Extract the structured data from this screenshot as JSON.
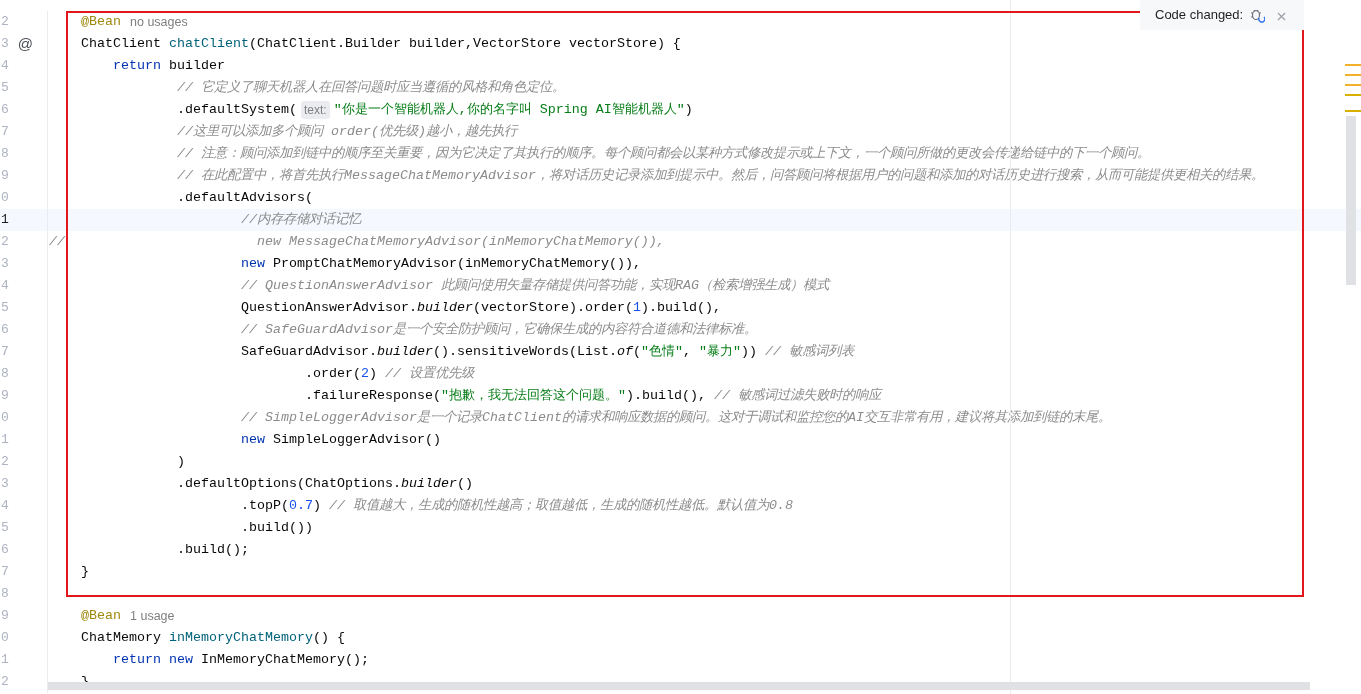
{
  "editor": {
    "lines": [
      {
        "number": "2",
        "current": false,
        "tokens": [
          {
            "text": "    @Bean",
            "kind": "annotation"
          },
          {
            "text": "no usages",
            "kind": "usage"
          }
        ]
      },
      {
        "number": "3",
        "current": false,
        "gutter_marker": "@",
        "tokens": [
          {
            "text": "    ChatClient ",
            "kind": "plain"
          },
          {
            "text": "chatClient",
            "kind": "declaration"
          },
          {
            "text": "(ChatClient.Builder builder,VectorStore vectorStore) {",
            "kind": "plain"
          }
        ]
      },
      {
        "number": "4",
        "current": false,
        "tokens": [
          {
            "text": "        return",
            "kind": "keyword"
          },
          {
            "text": " builder",
            "kind": "plain"
          }
        ]
      },
      {
        "number": "5",
        "current": false,
        "tokens": [
          {
            "text": "                // 它定义了聊天机器人在回答问题时应当遵循的风格和角色定位。",
            "kind": "comment"
          }
        ]
      },
      {
        "number": "6",
        "current": false,
        "tokens": [
          {
            "text": "                .defaultSystem(",
            "kind": "plain"
          },
          {
            "text": "text:",
            "kind": "hint"
          },
          {
            "text": "\"你是一个智能机器人,你的名字叫 Spring AI智能机器人\"",
            "kind": "string"
          },
          {
            "text": ")",
            "kind": "plain"
          }
        ]
      },
      {
        "number": "7",
        "current": false,
        "tokens": [
          {
            "text": "                //这里可以添加多个顾问 order(优先级)越小，越先执行",
            "kind": "comment"
          }
        ]
      },
      {
        "number": "8",
        "current": false,
        "tokens": [
          {
            "text": "                // 注意：顾问添加到链中的顺序至关重要，因为它决定了其执行的顺序。每个顾问都会以某种方式修改提示或上下文，一个顾问所做的更改会传递给链中的下一个顾问。",
            "kind": "comment"
          }
        ]
      },
      {
        "number": "9",
        "current": false,
        "tokens": [
          {
            "text": "                // 在此配置中，将首先执行MessageChatMemoryAdvisor，将对话历史记录添加到提示中。然后，问答顾问将根据用户的问题和添加的对话历史进行搜索，从而可能提供更相关的结果。",
            "kind": "comment"
          }
        ]
      },
      {
        "number": "0",
        "current": false,
        "tokens": [
          {
            "text": "                .defaultAdvisors(",
            "kind": "plain"
          }
        ]
      },
      {
        "number": "1",
        "current": true,
        "tokens": [
          {
            "text": "                        //内存存储对话记忆",
            "kind": "comment"
          }
        ]
      },
      {
        "number": "2",
        "current": false,
        "tokens": [
          {
            "text": "//                        new MessageChatMemoryAdvisor(inMemoryChatMemory()),",
            "kind": "comment"
          }
        ]
      },
      {
        "number": "3",
        "current": false,
        "tokens": [
          {
            "text": "                        new",
            "kind": "keyword"
          },
          {
            "text": " PromptChatMemoryAdvisor(inMemoryChatMemory()),",
            "kind": "plain"
          }
        ]
      },
      {
        "number": "4",
        "current": false,
        "tokens": [
          {
            "text": "                        // QuestionAnswerAdvisor 此顾问使用矢量存储提供问答功能，实现RAG（检索增强生成）模式",
            "kind": "comment"
          }
        ]
      },
      {
        "number": "5",
        "current": false,
        "tokens": [
          {
            "text": "                        QuestionAnswerAdvisor.",
            "kind": "plain"
          },
          {
            "text": "builder",
            "kind": "static"
          },
          {
            "text": "(vectorStore).order(",
            "kind": "plain"
          },
          {
            "text": "1",
            "kind": "number"
          },
          {
            "text": ").build(),",
            "kind": "plain"
          }
        ]
      },
      {
        "number": "6",
        "current": false,
        "tokens": [
          {
            "text": "                        // SafeGuardAdvisor是一个安全防护顾问，它确保生成的内容符合道德和法律标准。",
            "kind": "comment"
          }
        ]
      },
      {
        "number": "7",
        "current": false,
        "tokens": [
          {
            "text": "                        SafeGuardAdvisor.",
            "kind": "plain"
          },
          {
            "text": "builder",
            "kind": "static"
          },
          {
            "text": "().sensitiveWords(List.",
            "kind": "plain"
          },
          {
            "text": "of",
            "kind": "static"
          },
          {
            "text": "(",
            "kind": "plain"
          },
          {
            "text": "\"色情\"",
            "kind": "string"
          },
          {
            "text": ", ",
            "kind": "plain"
          },
          {
            "text": "\"暴力\"",
            "kind": "string"
          },
          {
            "text": ")) ",
            "kind": "plain"
          },
          {
            "text": "// 敏感词列表",
            "kind": "comment"
          }
        ]
      },
      {
        "number": "8",
        "current": false,
        "tokens": [
          {
            "text": "                                .order(",
            "kind": "plain"
          },
          {
            "text": "2",
            "kind": "number"
          },
          {
            "text": ") ",
            "kind": "plain"
          },
          {
            "text": "// 设置优先级",
            "kind": "comment"
          }
        ]
      },
      {
        "number": "9",
        "current": false,
        "tokens": [
          {
            "text": "                                .failureResponse(",
            "kind": "plain"
          },
          {
            "text": "\"抱歉，我无法回答这个问题。\"",
            "kind": "string"
          },
          {
            "text": ").build(), ",
            "kind": "plain"
          },
          {
            "text": "// 敏感词过滤失败时的响应",
            "kind": "comment"
          }
        ]
      },
      {
        "number": "0",
        "current": false,
        "tokens": [
          {
            "text": "                        // SimpleLoggerAdvisor是一个记录ChatClient的请求和响应数据的顾问。这对于调试和监控您的AI交互非常有用，建议将其添加到链的末尾。",
            "kind": "comment"
          }
        ]
      },
      {
        "number": "1",
        "current": false,
        "tokens": [
          {
            "text": "                        new",
            "kind": "keyword"
          },
          {
            "text": " SimpleLoggerAdvisor()",
            "kind": "plain"
          }
        ]
      },
      {
        "number": "2",
        "current": false,
        "tokens": [
          {
            "text": "                )",
            "kind": "plain"
          }
        ]
      },
      {
        "number": "3",
        "current": false,
        "tokens": [
          {
            "text": "                .defaultOptions(ChatOptions.",
            "kind": "plain"
          },
          {
            "text": "builder",
            "kind": "static"
          },
          {
            "text": "()",
            "kind": "plain"
          }
        ]
      },
      {
        "number": "4",
        "current": false,
        "tokens": [
          {
            "text": "                        .topP(",
            "kind": "plain"
          },
          {
            "text": "0.7",
            "kind": "number"
          },
          {
            "text": ") ",
            "kind": "plain"
          },
          {
            "text": "// 取值越大，生成的随机性越高；取值越低，生成的随机性越低。默认值为0.8",
            "kind": "comment"
          }
        ]
      },
      {
        "number": "5",
        "current": false,
        "tokens": [
          {
            "text": "                        .build())",
            "kind": "plain"
          }
        ]
      },
      {
        "number": "6",
        "current": false,
        "tokens": [
          {
            "text": "                .build();",
            "kind": "plain"
          }
        ]
      },
      {
        "number": "7",
        "current": false,
        "tokens": [
          {
            "text": "    }",
            "kind": "plain"
          }
        ]
      },
      {
        "number": "8",
        "current": false
      },
      {
        "number": "9",
        "current": false,
        "tokens": [
          {
            "text": "    @Bean",
            "kind": "annotation"
          },
          {
            "text": "1 usage",
            "kind": "usage"
          }
        ]
      },
      {
        "number": "0",
        "current": false,
        "tokens": [
          {
            "text": "    ChatMemory ",
            "kind": "plain"
          },
          {
            "text": "inMemoryChatMemory",
            "kind": "declaration"
          },
          {
            "text": "() {",
            "kind": "plain"
          }
        ]
      },
      {
        "number": "1",
        "current": false,
        "tokens": [
          {
            "text": "        return",
            "kind": "keyword"
          },
          {
            "text": " new",
            "kind": "keyword"
          },
          {
            "text": " InMemoryChatMemory();",
            "kind": "plain"
          }
        ]
      },
      {
        "number": "2",
        "current": false,
        "tokens": [
          {
            "text": "    }",
            "kind": "plain"
          }
        ]
      }
    ]
  },
  "notification": {
    "text": "Code changed:"
  }
}
